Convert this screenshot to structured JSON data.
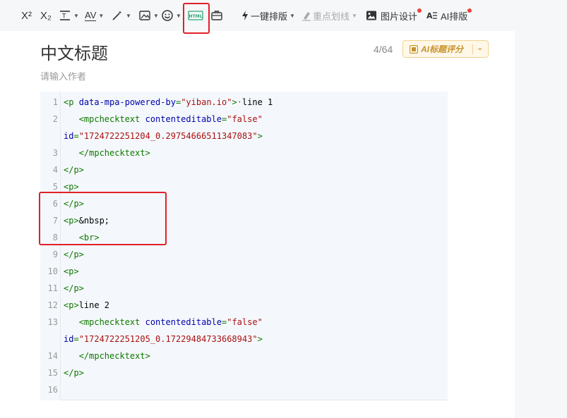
{
  "toolbar": {
    "superscript": "X²",
    "subscript": "X₂",
    "line_spacing_icon": "line-spacing",
    "letter_spacing": "AV",
    "magic_wand_icon": "magic-wand",
    "image_icon": "image",
    "emoji_icon": "emoji",
    "html_label": "HTML",
    "template_icon": "briefcase",
    "one_click_format": "一键排版",
    "highlight_line": "重点划线",
    "image_design": "图片设计",
    "ai_layout": "AI排版"
  },
  "header": {
    "title": "中文标题",
    "counter": "4/64",
    "ai_score": "AI标题评分",
    "author_placeholder": "请输入作者"
  },
  "editor": {
    "lines": [
      {
        "n": "1",
        "parts": [
          [
            "tag",
            "<p "
          ],
          [
            "attr",
            "data-mpa-powered-by"
          ],
          [
            "tag",
            "="
          ],
          [
            "str",
            "\"yiban.io\""
          ],
          [
            "tag",
            ">"
          ],
          [
            "ws",
            "·"
          ],
          [
            "txt",
            "line 1"
          ]
        ]
      },
      {
        "n": "2",
        "parts": [
          [
            "txt",
            "   "
          ],
          [
            "tag",
            "<mpchecktext "
          ],
          [
            "attr",
            "contenteditable"
          ],
          [
            "tag",
            "="
          ],
          [
            "str",
            "\"false\""
          ]
        ]
      },
      {
        "n": "",
        "parts": [
          [
            "attr",
            "id"
          ],
          [
            "tag",
            "="
          ],
          [
            "str",
            "\"1724722251204_0.29754666511347083\""
          ],
          [
            "tag",
            ">"
          ]
        ]
      },
      {
        "n": "3",
        "parts": [
          [
            "txt",
            "   "
          ],
          [
            "tag",
            "</mpchecktext>"
          ]
        ]
      },
      {
        "n": "4",
        "parts": [
          [
            "tag",
            "</p>"
          ]
        ]
      },
      {
        "n": "5",
        "parts": [
          [
            "tag",
            "<p>"
          ]
        ]
      },
      {
        "n": "6",
        "parts": [
          [
            "tag",
            "</p>"
          ]
        ]
      },
      {
        "n": "7",
        "parts": [
          [
            "tag",
            "<p>"
          ],
          [
            "txt",
            "&nbsp;"
          ]
        ]
      },
      {
        "n": "8",
        "parts": [
          [
            "txt",
            "   "
          ],
          [
            "tag",
            "<br>"
          ]
        ]
      },
      {
        "n": "9",
        "parts": [
          [
            "tag",
            "</p>"
          ]
        ]
      },
      {
        "n": "10",
        "parts": [
          [
            "tag",
            "<p>"
          ]
        ]
      },
      {
        "n": "11",
        "parts": [
          [
            "tag",
            "</p>"
          ]
        ]
      },
      {
        "n": "12",
        "parts": [
          [
            "tag",
            "<p>"
          ],
          [
            "txt",
            "line 2"
          ]
        ]
      },
      {
        "n": "13",
        "parts": [
          [
            "txt",
            "   "
          ],
          [
            "tag",
            "<mpchecktext "
          ],
          [
            "attr",
            "contenteditable"
          ],
          [
            "tag",
            "="
          ],
          [
            "str",
            "\"false\""
          ]
        ]
      },
      {
        "n": "",
        "parts": [
          [
            "attr",
            "id"
          ],
          [
            "tag",
            "="
          ],
          [
            "str",
            "\"1724722251205_0.17229484733668943\""
          ],
          [
            "tag",
            ">"
          ]
        ]
      },
      {
        "n": "14",
        "parts": [
          [
            "txt",
            "   "
          ],
          [
            "tag",
            "</mpchecktext>"
          ]
        ]
      },
      {
        "n": "15",
        "parts": [
          [
            "tag",
            "</p>"
          ]
        ]
      },
      {
        "n": "16",
        "parts": []
      }
    ]
  },
  "colors": {
    "highlight": "#e0202a",
    "tag": "#117700",
    "attr": "#0000aa",
    "string": "#aa1111",
    "notify_dot": "#e8453c",
    "ai_accent": "#c9912b"
  }
}
